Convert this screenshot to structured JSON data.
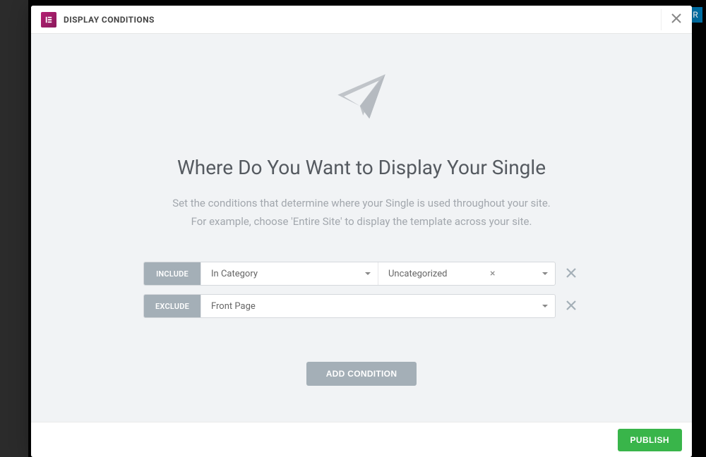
{
  "background": {
    "blue_btn": "R"
  },
  "header": {
    "title": "DISPLAY CONDITIONS"
  },
  "main": {
    "heading": "Where Do You Want to Display Your Single",
    "description_line1": "Set the conditions that determine where your Single is used throughout your site.",
    "description_line2": "For example, choose 'Entire Site' to display the template across your site."
  },
  "conditions": [
    {
      "badge": "INCLUDE",
      "select1": "In Category",
      "select2": "Uncategorized"
    },
    {
      "badge": "EXCLUDE",
      "select1": "Front Page"
    }
  ],
  "buttons": {
    "add_condition": "ADD CONDITION",
    "publish": "PUBLISH"
  }
}
